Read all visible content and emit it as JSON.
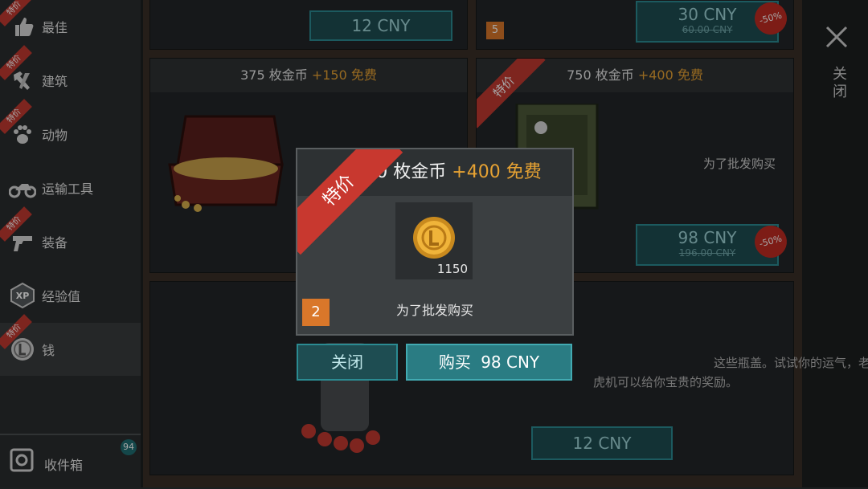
{
  "sidebar": {
    "items": [
      {
        "label": "最佳",
        "icon": "thumbs-up-icon",
        "ribbon": "特价"
      },
      {
        "label": "建筑",
        "icon": "hammer-icon",
        "ribbon": "特价"
      },
      {
        "label": "动物",
        "icon": "paw-icon",
        "ribbon": "特价"
      },
      {
        "label": "运输工具",
        "icon": "motorcycle-icon",
        "ribbon": ""
      },
      {
        "label": "装备",
        "icon": "pistol-icon",
        "ribbon": "特价"
      },
      {
        "label": "经验值",
        "icon": "xp-icon",
        "ribbon": ""
      },
      {
        "label": "钱",
        "icon": "coin-icon",
        "ribbon": "特价"
      }
    ],
    "inbox_label": "收件箱",
    "inbox_count": "94"
  },
  "cards": {
    "top_left_price": "12 CNY",
    "top_right_price": "30 CNY",
    "top_right_old_price": "60.00 CNY",
    "top_right_discount": "-50%",
    "top_right_badge": "5",
    "mid_left_title_num": "375 枚金币",
    "mid_left_bonus": "+150 免费",
    "mid_right_title_num": "750 枚金币",
    "mid_right_bonus": "+400 免费",
    "mid_right_ribbon": "特价",
    "mid_right_sub": "为了批发购买",
    "mid_right_price": "98 CNY",
    "mid_right_old_price": "196.00 CNY",
    "mid_right_discount": "-50%",
    "bottom_desc_line1": "这些瓶盖。试试你的运气，老",
    "bottom_desc_line2": "虎机可以给你宝贵的奖励。",
    "bottom_price": "12 CNY"
  },
  "close_label": "关闭",
  "dialog": {
    "ribbon": "特价",
    "title_num": "0 枚金币",
    "title_bonus": "+400 免费",
    "coin_qty": "1150",
    "badge": "2",
    "subtitle": "为了批发购买",
    "close_button": "关闭",
    "buy_button": "购买",
    "buy_price": "98 CNY"
  },
  "colors": {
    "accent": "#2b8b92",
    "gold": "#e6a233",
    "ribbon": "#c23a31"
  }
}
